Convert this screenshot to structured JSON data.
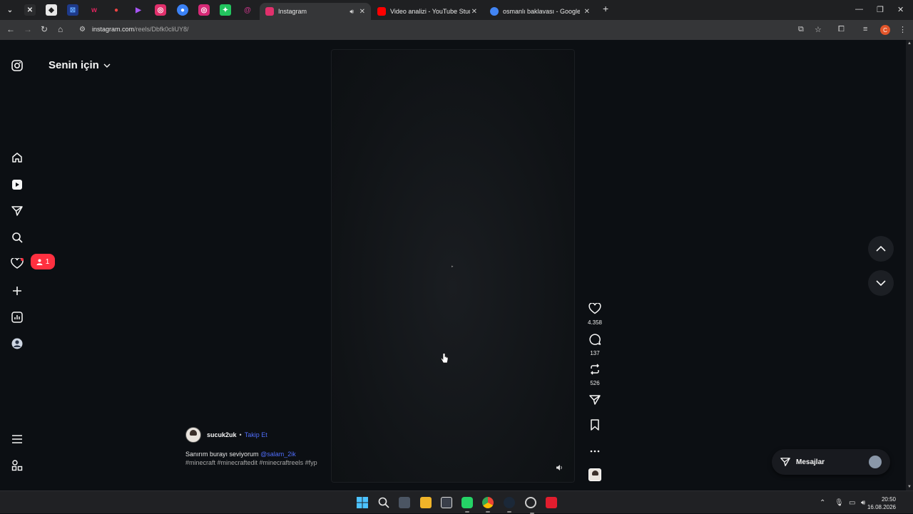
{
  "browser": {
    "pinned_tabs": [
      {
        "icon": "chevron-down-icon",
        "color": "#cfcfcf"
      },
      {
        "icon": "muted-speaker-icon",
        "color": "#e8e8e8"
      },
      {
        "icon": "app-icon",
        "color": "#e8e8e8"
      },
      {
        "icon": "app-icon",
        "color": "#3b82f6"
      },
      {
        "icon": "app-icon",
        "color": "#e0245e"
      },
      {
        "icon": "app-icon",
        "color": "#ef4444"
      },
      {
        "icon": "app-icon",
        "color": "#a855f7"
      },
      {
        "icon": "instagram-icon",
        "color": "#e1306c"
      },
      {
        "icon": "app-icon",
        "color": "#3b82f6"
      },
      {
        "icon": "instagram-icon",
        "color": "#d62976"
      },
      {
        "icon": "app-icon",
        "color": "#22c55e"
      },
      {
        "icon": "threads-icon",
        "color": "#c13584"
      }
    ],
    "tabs": [
      {
        "title": "Instagram",
        "active": true,
        "color": "#e1306c"
      },
      {
        "title": "Video analizi - YouTube Studio",
        "active": false,
        "color": "#ff0000"
      },
      {
        "title": "osmanlı baklavası - Google'da A",
        "active": false,
        "color": "#4285f4"
      }
    ],
    "url_host": "instagram.com",
    "url_path": "/reels/Dbfk0cliUY8/",
    "profile_letter": "C"
  },
  "sidebar": {
    "feed_title": "Senin için",
    "notification_count": "1",
    "items": [
      "home-icon",
      "reels-icon",
      "direct-icon",
      "search-icon",
      "heart-icon",
      "create-icon",
      "dashboard-icon",
      "profile-icon"
    ]
  },
  "reel": {
    "likes": "4.358",
    "comments": "137",
    "reposts": "526",
    "author": "sucuk2uk",
    "separator": "•",
    "follow_label": "Takip Et",
    "caption_text": "Sanırım burayı seviyorum",
    "caption_mention": "@salam_2ik",
    "tags": "#minecraft #minecraftedit #minecraftreels #fyp"
  },
  "messages": {
    "label": "Mesajlar"
  },
  "taskbar": {
    "time": "20:50",
    "date": "16.08.2026"
  },
  "colors": {
    "accent_blue": "#4f6dfa",
    "badge_red": "#ff3040",
    "background": "#0c0f13"
  }
}
